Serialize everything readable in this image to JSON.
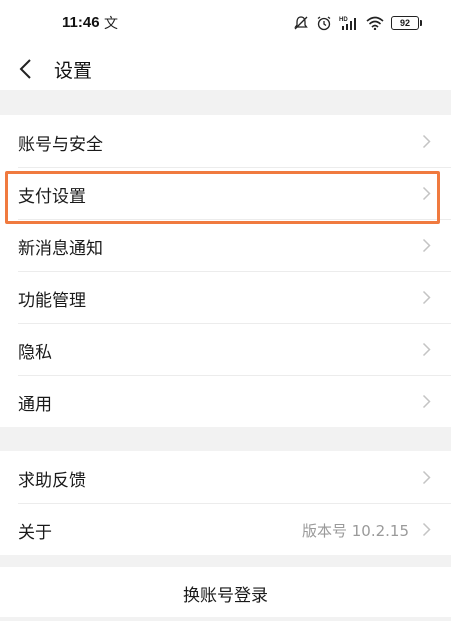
{
  "status_bar": {
    "time": "11:46",
    "message_icon": "文",
    "battery": "92",
    "signal_label": "HD"
  },
  "nav": {
    "title": "设置"
  },
  "group1": {
    "items": [
      {
        "label": "账号与安全"
      },
      {
        "label": "支付设置"
      },
      {
        "label": "新消息通知"
      },
      {
        "label": "功能管理"
      },
      {
        "label": "隐私"
      },
      {
        "label": "通用"
      }
    ]
  },
  "group2": {
    "items": [
      {
        "label": "求助反馈"
      },
      {
        "label": "关于",
        "value": "版本号 10.2.15"
      }
    ]
  },
  "footer": {
    "switch_account_label": "换账号登录"
  },
  "colors": {
    "highlight": "#f07a3f",
    "background": "#f2f2f2",
    "secondary_text": "#9a9a9a"
  }
}
